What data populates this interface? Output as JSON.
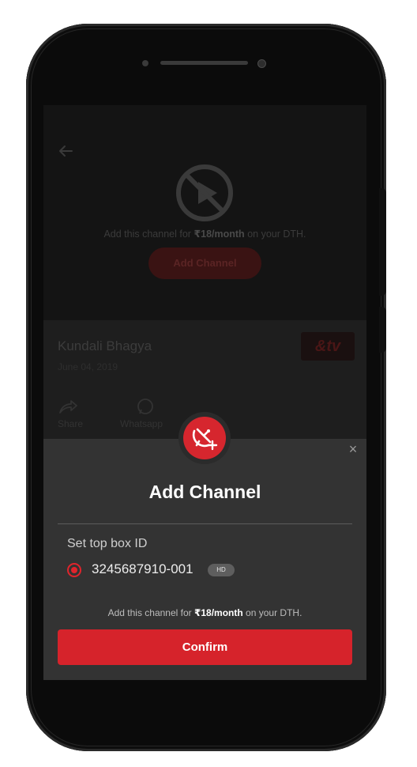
{
  "player": {
    "message_prefix": "Add this channel for",
    "price": "₹18/month",
    "message_suffix": "on your DTH.",
    "add_button_label": "Add Channel"
  },
  "show": {
    "title": "Kundali Bhagya",
    "date": "June 04, 2019",
    "channel_logo_text": "&tv",
    "actions": {
      "share_label": "Share",
      "whatsapp_label": "Whatsapp"
    }
  },
  "sheet": {
    "title": "Add Channel",
    "close_glyph": "×",
    "stb_label": "Set top box ID",
    "stb_id": "3245687910-001",
    "stb_badge": "HD",
    "message_prefix": "Add this channel for",
    "price": "₹18/month",
    "message_suffix": "on your DTH.",
    "confirm_label": "Confirm"
  },
  "colors": {
    "accent": "#d6232b",
    "sheet_bg": "#333333",
    "screen_bg": "#1c1c1c"
  },
  "icons": [
    "back-arrow-icon",
    "blocked-play-icon",
    "share-icon",
    "whatsapp-icon",
    "satellite-add-icon",
    "close-icon"
  ]
}
